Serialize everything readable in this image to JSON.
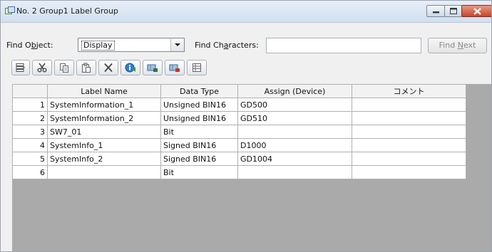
{
  "window": {
    "title": "No. 2 Group1 Label Group",
    "controls": [
      "minimize-icon",
      "maximize-icon",
      "close-icon"
    ]
  },
  "find": {
    "object_label_pre": "Find O",
    "object_label_key": "b",
    "object_label_post": "ject:",
    "object_value": "Display",
    "chars_label_pre": "Find Ch",
    "chars_label_key": "a",
    "chars_label_post": "racters:",
    "chars_value": "",
    "next_pre": "Find ",
    "next_key": "N",
    "next_post": "ext"
  },
  "toolbar": {
    "buttons": [
      "insert-row-icon",
      "cut-icon",
      "copy-icon",
      "paste-icon",
      "delete-icon",
      "info-icon",
      "import-icon",
      "export-icon",
      "properties-icon"
    ]
  },
  "grid": {
    "columns": [
      "",
      "Label Name",
      "Data Type",
      "Assign (Device)",
      "コメント"
    ],
    "rows": [
      [
        "1",
        "SystemInformation_1",
        "Unsigned BIN16",
        "GD500",
        ""
      ],
      [
        "2",
        "SystemInformation_2",
        "Unsigned BIN16",
        "GD510",
        ""
      ],
      [
        "3",
        "SW7_01",
        "Bit",
        "",
        ""
      ],
      [
        "4",
        "SystemInfo_1",
        "Signed BIN16",
        "D1000",
        ""
      ],
      [
        "5",
        "SystemInfo_2",
        "Signed BIN16",
        "GD1004",
        ""
      ],
      [
        "6",
        "",
        "Bit",
        "",
        ""
      ]
    ]
  },
  "colors": {
    "titlebar": "#d2dfef",
    "close_button": "#c6452a",
    "grid_background": "#aaaaaa",
    "panel": "#f0f0f0"
  }
}
